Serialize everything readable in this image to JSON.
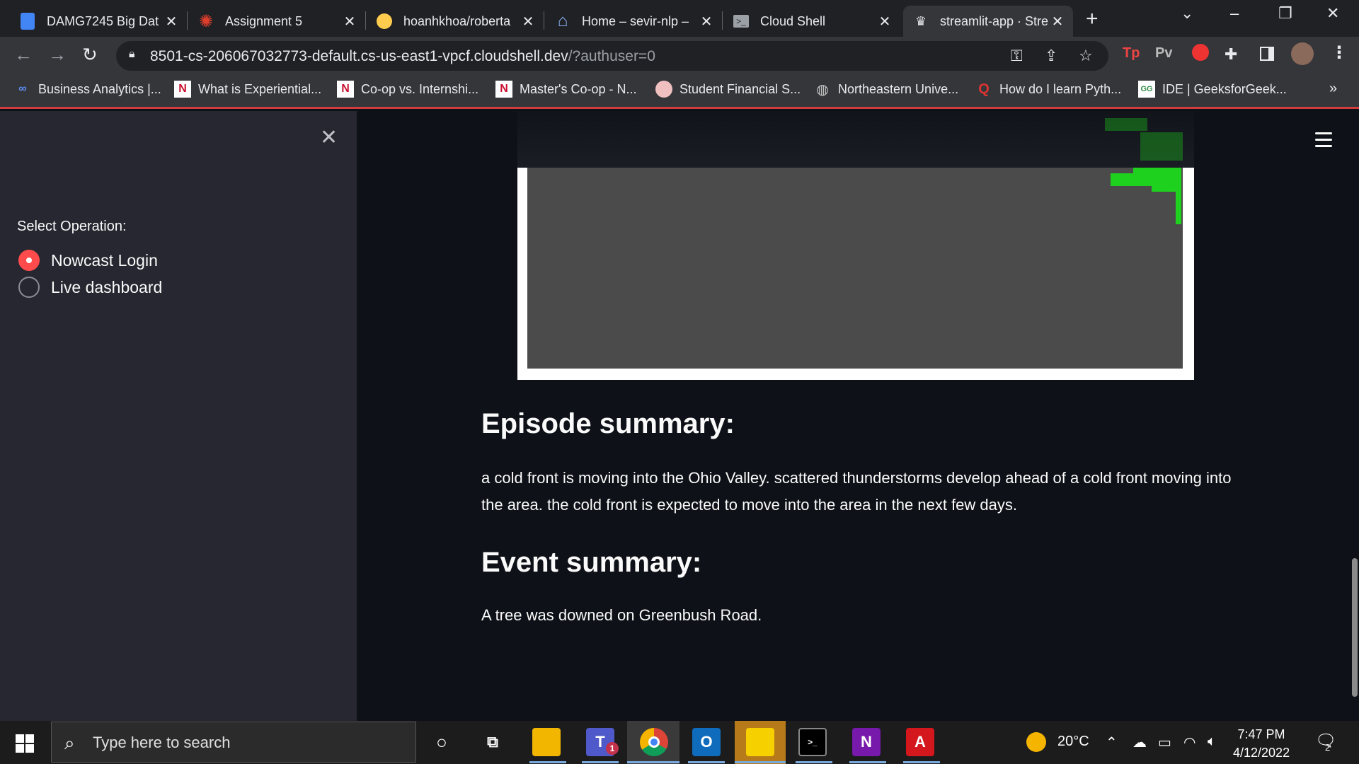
{
  "browser": {
    "tabs": [
      {
        "title": "DAMG7245 Big Dat",
        "icon": "docs-icon",
        "active": false
      },
      {
        "title": "Assignment 5",
        "icon": "canvas-icon",
        "active": false
      },
      {
        "title": "hoanhkhoa/roberta",
        "icon": "huggingface-icon",
        "active": false
      },
      {
        "title": "Home – sevir-nlp –",
        "icon": "home-icon",
        "active": false
      },
      {
        "title": "Cloud Shell",
        "icon": "terminal-icon",
        "active": false
      },
      {
        "title": "streamlit-app · Stre",
        "icon": "streamlit-icon",
        "active": true
      }
    ],
    "url_main": "8501-cs-206067032773-default.cs-us-east1-vpcf.cloudshell.dev",
    "url_rest": "/?authuser=0",
    "extensions": [
      "Tp",
      "Pv"
    ],
    "bookmarks": [
      {
        "label": "Business Analytics |...",
        "icon": "co"
      },
      {
        "label": "What is Experiential...",
        "icon": "N"
      },
      {
        "label": "Co-op vs. Internshi...",
        "icon": "N"
      },
      {
        "label": "Master's Co-op - N...",
        "icon": "N"
      },
      {
        "label": "Student Financial S...",
        "icon": "seal"
      },
      {
        "label": "Northeastern Unive...",
        "icon": "globe"
      },
      {
        "label": "How do I learn Pyth...",
        "icon": "Q"
      },
      {
        "label": "IDE | GeeksforGeek...",
        "icon": "GfG"
      }
    ],
    "bookmarks_overflow": "»"
  },
  "sidebar": {
    "label": "Select Operation:",
    "options": [
      {
        "label": "Nowcast Login",
        "selected": true
      },
      {
        "label": "Live dashboard",
        "selected": false
      }
    ]
  },
  "main": {
    "episode_heading": "Episode summary:",
    "episode_text": "a cold front is moving into the Ohio Valley. scattered thunderstorms develop ahead of a cold front moving into the area. the cold front is expected to move into the area in the next few days.",
    "event_heading": "Event summary:",
    "event_text": "A tree was downed on Greenbush Road."
  },
  "taskbar": {
    "search_placeholder": "Type here to search",
    "teams_badge": "1",
    "weather": "20°C",
    "time": "7:47 PM",
    "date": "4/12/2022",
    "notifications": "2"
  },
  "colors": {
    "accent": "#ff4b4b",
    "sidebar_bg": "#262730",
    "main_bg": "#0e1117"
  }
}
